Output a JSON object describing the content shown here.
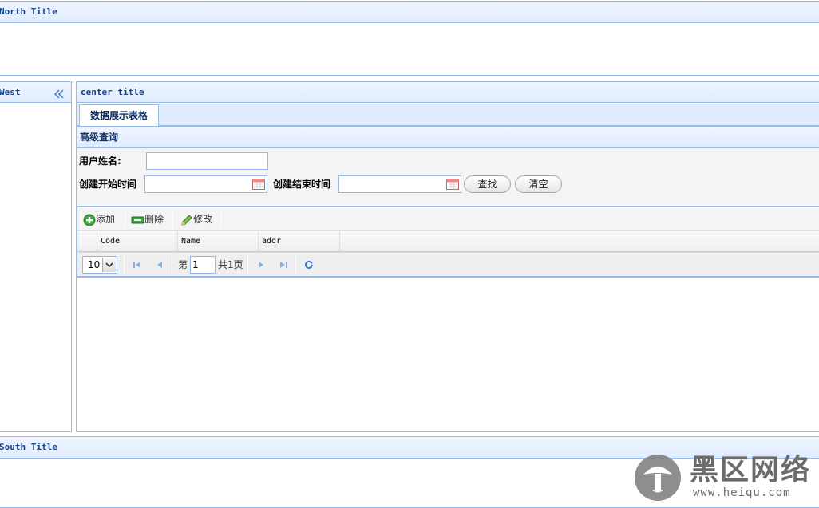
{
  "north": {
    "title": "North Title"
  },
  "west": {
    "title": "West",
    "collapse_icon": "double-chevron-left-icon"
  },
  "center": {
    "title": "center title",
    "tabs": [
      {
        "label": "数据展示表格",
        "active": true
      }
    ],
    "advanced_search": {
      "title": "高级查询",
      "user_name_label": "用户姓名:",
      "user_name_value": "",
      "start_time_label": "创建开始时间",
      "start_time_value": "",
      "end_time_label": "创建结束时间",
      "end_time_value": "",
      "search_button": "查找",
      "clear_button": "清空"
    },
    "grid": {
      "toolbar": [
        {
          "label": "添加",
          "icon": "add-icon"
        },
        {
          "label": "删除",
          "icon": "remove-icon"
        },
        {
          "label": "修改",
          "icon": "edit-icon"
        }
      ],
      "columns": [
        "Code",
        "Name",
        "addr"
      ],
      "rows": [],
      "pager": {
        "page_size": "10",
        "page_prefix": "第",
        "page_number": "1",
        "page_total": "共1页"
      }
    }
  },
  "south": {
    "title": "South Title"
  },
  "watermark": {
    "text": "黑区网络",
    "url": "www.heiqu.com"
  },
  "colors": {
    "border": "#99bbe8",
    "header_text": "#15428b",
    "header_bg": "#e0ecff"
  }
}
